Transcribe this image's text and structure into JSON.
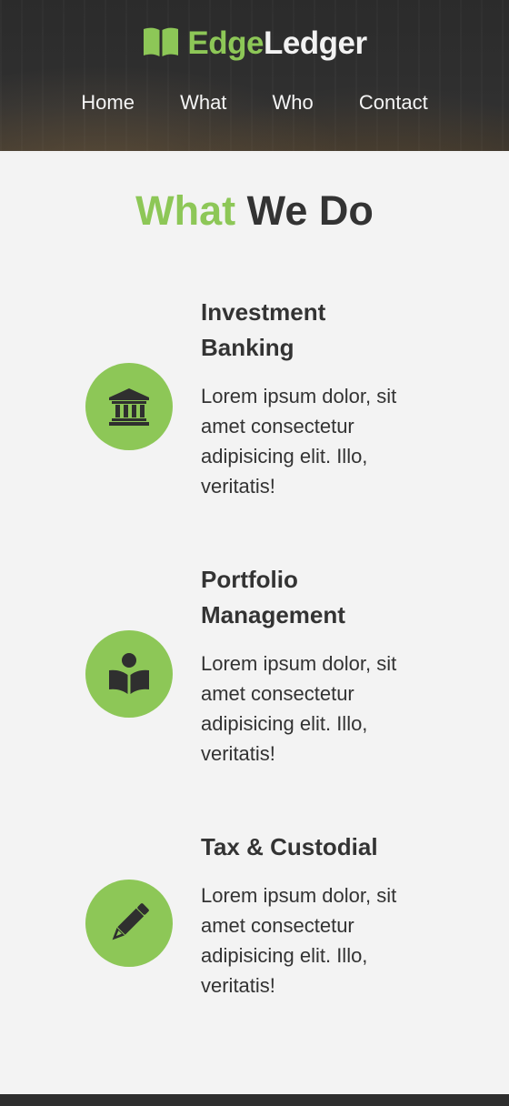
{
  "brand": {
    "name_part1": "Edge",
    "name_part2": "Ledger",
    "icon": "open-book-icon"
  },
  "nav": {
    "items": [
      "Home",
      "What",
      "Who",
      "Contact"
    ]
  },
  "section": {
    "title_part1": "What",
    "title_part2": "We Do"
  },
  "services": [
    {
      "icon": "bank-building-icon",
      "title_line1": "Investment",
      "title_line2": "Banking",
      "desc_lines": [
        "Lorem ipsum dolor, sit",
        "amet consectetur",
        "adipisicing elit. Illo,",
        "veritatis!"
      ]
    },
    {
      "icon": "reader-book-icon",
      "title_line1": "Portfolio",
      "title_line2": "Management",
      "desc_lines": [
        "Lorem ipsum dolor, sit",
        "amet consectetur",
        "adipisicing elit. Illo,",
        "veritatis!"
      ]
    },
    {
      "icon": "pencil-icon",
      "title_line1": "Tax & Custodial",
      "desc_lines": [
        "Lorem ipsum dolor, sit",
        "amet consectetur",
        "adipisicing elit. Illo,",
        "veritatis!"
      ]
    }
  ],
  "colors": {
    "accent": "#8dc757",
    "text": "#333333",
    "background": "#f3f3f3",
    "header": "#2b2b2b"
  }
}
